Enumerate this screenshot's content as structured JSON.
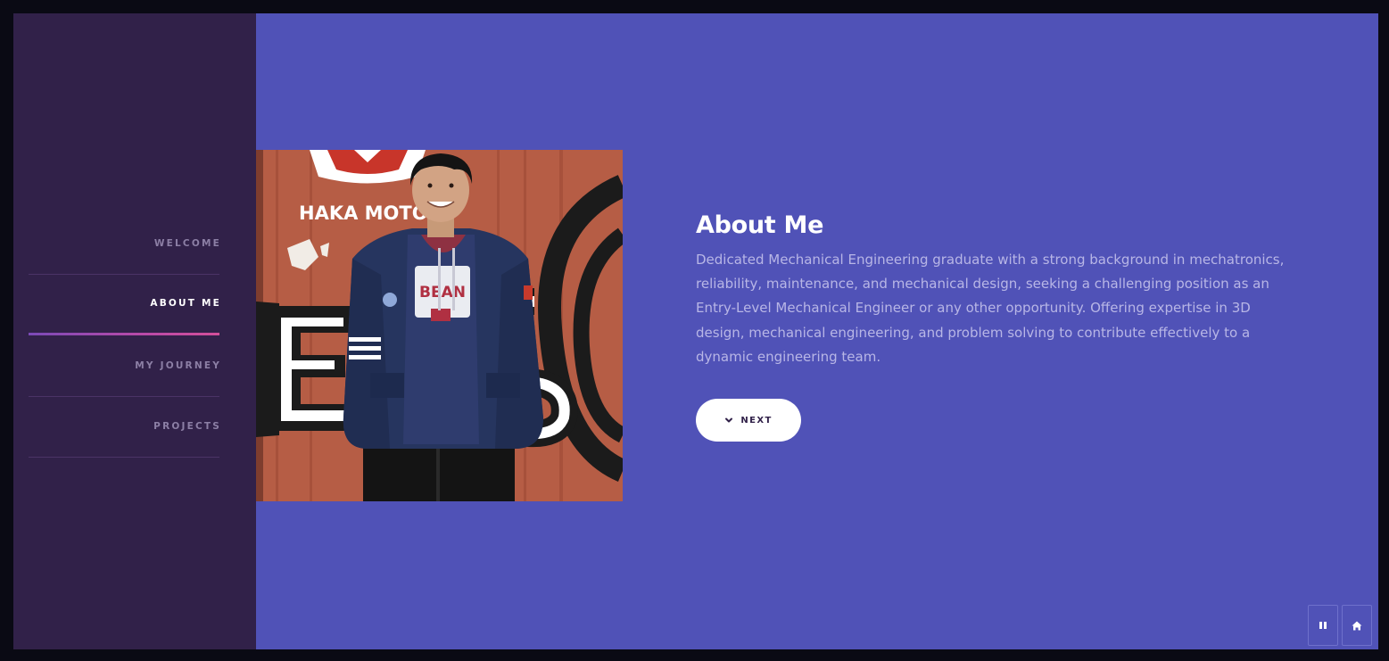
{
  "nav": {
    "items": [
      {
        "label": "WELCOME",
        "active": false
      },
      {
        "label": "ABOUT ME",
        "active": true
      },
      {
        "label": "MY JOURNEY",
        "active": false
      },
      {
        "label": "PROJECTS",
        "active": false
      }
    ]
  },
  "about": {
    "title": "About Me",
    "description": "Dedicated Mechanical Engineering graduate with a strong background in mechatronics, reliability, maintenance, and mechanical design, seeking a challenging position as an Entry-Level Mechanical Engineer or any other opportunity. Offering expertise in 3D design, mechanical engineering, and problem solving to contribute effectively to a dynamic engineering team.",
    "next_label": "NEXT",
    "next_icon": "chevron-down-icon",
    "photo_sign_text": "HAKA MOTO"
  },
  "controls": {
    "pause_icon": "pause-icon",
    "home_icon": "home-icon"
  },
  "colors": {
    "sidebar_bg": "#312149",
    "main_bg": "#5052b7",
    "accent_gradient_start": "#7b4ab8",
    "accent_gradient_end": "#d34f9a",
    "text_white": "#ffffff",
    "text_muted": "#b8b6e6"
  }
}
